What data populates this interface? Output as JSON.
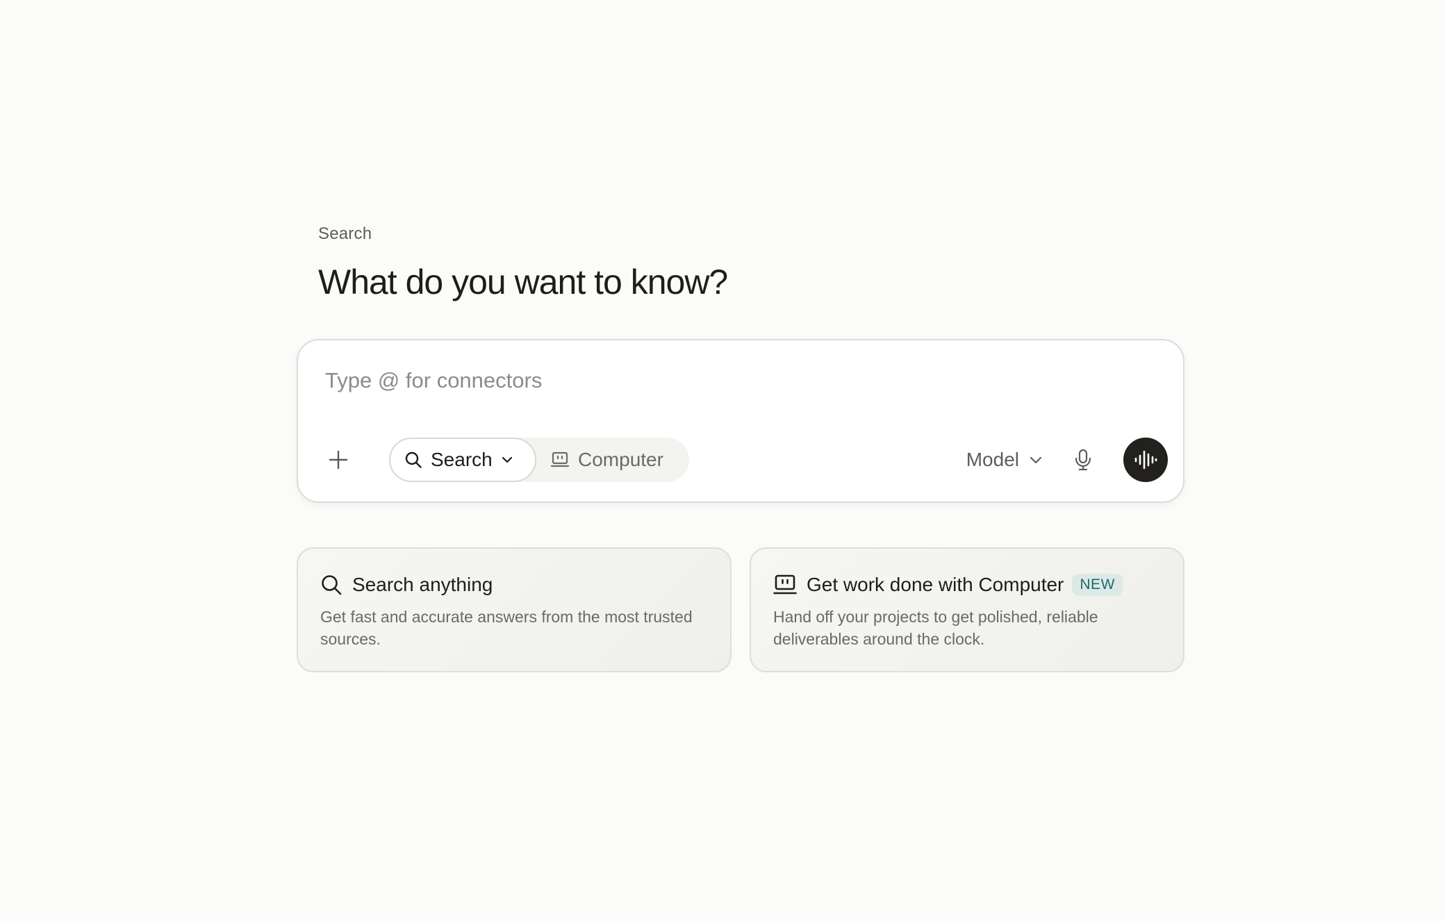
{
  "header": {
    "eyebrow": "Search",
    "title": "What do you want to know?"
  },
  "composer": {
    "placeholder": "Type @ for connectors",
    "value": "",
    "attach_icon": "plus-icon",
    "modes": [
      {
        "label": "Search",
        "icon": "search-icon",
        "selected": true,
        "has_dropdown": true
      },
      {
        "label": "Computer",
        "icon": "computer-icon",
        "selected": false
      }
    ],
    "model_label": "Model",
    "mic_icon": "microphone-icon",
    "voice_icon": "voice-waveform-icon"
  },
  "cards": [
    {
      "icon": "search-icon",
      "title": "Search anything",
      "description": "Get fast and accurate answers from the most trusted sources."
    },
    {
      "icon": "computer-icon",
      "title": "Get work done with Computer",
      "badge": "NEW",
      "description": "Hand off your projects to get polished, reliable deliverables around the clock."
    }
  ],
  "colors": {
    "background": "#fbfbf9",
    "voice_button": "#22211e",
    "badge_bg": "#dde9e7",
    "badge_text": "#1c6b6a"
  }
}
